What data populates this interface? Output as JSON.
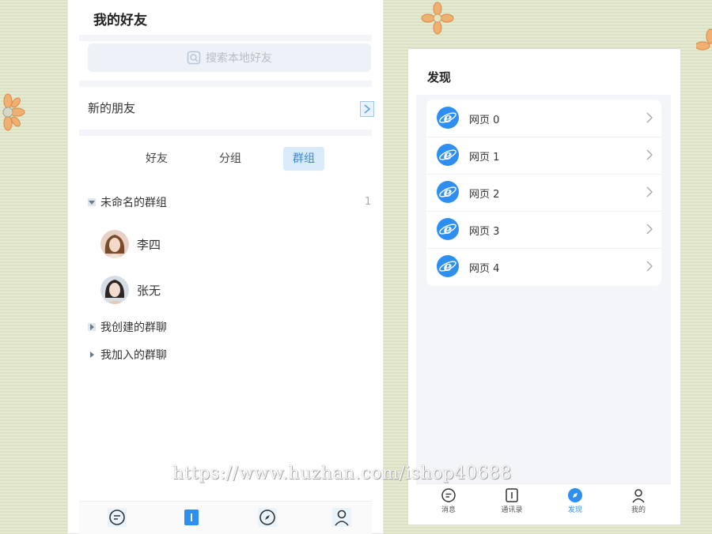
{
  "left_panel": {
    "title": "我的好友",
    "search_placeholder": "搜索本地好友",
    "new_friends_label": "新的朋友",
    "tabs": [
      {
        "label": "好友",
        "active": false
      },
      {
        "label": "分组",
        "active": false
      },
      {
        "label": "群组",
        "active": true
      }
    ],
    "groups": [
      {
        "label": "未命名的群组",
        "count": "1",
        "expanded": true
      },
      {
        "label": "我创建的群聊",
        "expanded": false
      },
      {
        "label": "我加入的群聊",
        "expanded": false
      }
    ],
    "contacts": [
      {
        "name": "李四"
      },
      {
        "name": "张无"
      }
    ],
    "bottom_nav_icons": [
      "chat-icon",
      "contacts-icon",
      "compass-icon",
      "user-icon"
    ]
  },
  "right_panel": {
    "title": "发现",
    "items": [
      {
        "label": "网页 0",
        "icon": "ie-icon"
      },
      {
        "label": "网页 1",
        "icon": "ie-icon"
      },
      {
        "label": "网页 2",
        "icon": "ie-icon"
      },
      {
        "label": "网页 3",
        "icon": "ie-icon"
      },
      {
        "label": "网页 4",
        "icon": "ie-icon"
      }
    ],
    "bottom_nav": [
      {
        "label": "消息",
        "icon": "chat-icon",
        "active": false
      },
      {
        "label": "通讯录",
        "icon": "contacts-icon",
        "active": false
      },
      {
        "label": "发现",
        "icon": "compass-icon",
        "active": true
      },
      {
        "label": "我的",
        "icon": "user-icon",
        "active": false
      }
    ]
  },
  "watermark": "https://www.huzhan.com/ishop40688",
  "colors": {
    "accent": "#2f8ef2",
    "tab_active_bg": "#d9ebfb",
    "background": "#dfe6c6"
  }
}
